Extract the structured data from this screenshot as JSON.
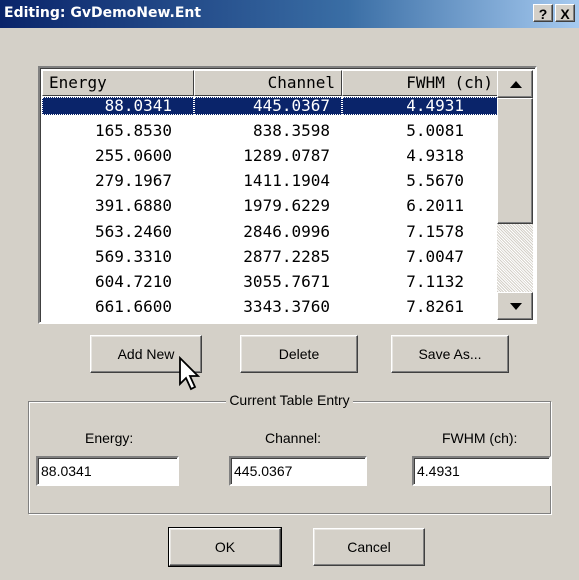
{
  "window": {
    "title": "Editing: GvDemoNew.Ent",
    "help_btn": "?",
    "close_btn": "X"
  },
  "table": {
    "headers": [
      "Energy",
      "Channel",
      "FWHM (ch)"
    ],
    "rows": [
      [
        "88.0341",
        "445.0367",
        "4.4931"
      ],
      [
        "165.8530",
        "838.3598",
        "5.0081"
      ],
      [
        "255.0600",
        "1289.0787",
        "4.9318"
      ],
      [
        "279.1967",
        "1411.1904",
        "5.5670"
      ],
      [
        "391.6880",
        "1979.6229",
        "6.2011"
      ],
      [
        "563.2460",
        "2846.0996",
        "7.1578"
      ],
      [
        "569.3310",
        "2877.2285",
        "7.0047"
      ],
      [
        "604.7210",
        "3055.7671",
        "7.1132"
      ],
      [
        "661.6600",
        "3343.3760",
        "7.8261"
      ]
    ],
    "selected_row": 0
  },
  "buttons": {
    "add_new": "Add New",
    "delete": "Delete",
    "save_as": "Save As...",
    "ok": "OK",
    "cancel": "Cancel"
  },
  "current_entry": {
    "group_label": "Current Table Entry",
    "energy_label": "Energy:",
    "channel_label": "Channel:",
    "fwhm_label": "FWHM (ch):",
    "energy_value": "88.0341",
    "channel_value": "445.0367",
    "fwhm_value": "4.4931"
  },
  "colors": {
    "title_bar": "#0a246a",
    "selection": "#0a246a",
    "face": "#d4d0c8"
  },
  "icons": [
    "help-icon",
    "close-icon",
    "scroll-up-arrow-icon",
    "scroll-down-arrow-icon",
    "mouse-pointer-icon"
  ]
}
